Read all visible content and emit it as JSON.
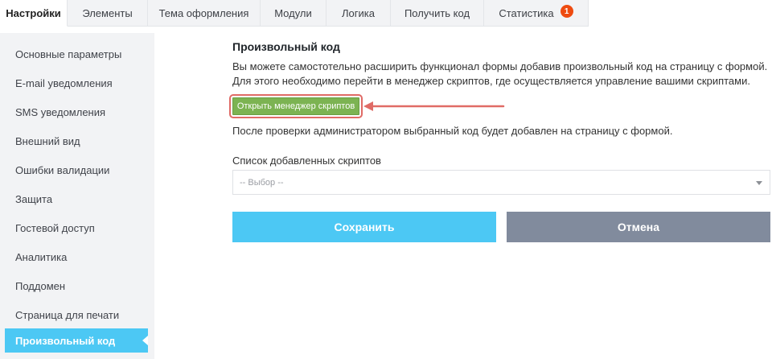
{
  "tabs": [
    {
      "label": "Настройки",
      "active": true
    },
    {
      "label": "Элементы"
    },
    {
      "label": "Тема оформления"
    },
    {
      "label": "Модули"
    },
    {
      "label": "Логика"
    },
    {
      "label": "Получить код"
    },
    {
      "label": "Статистика",
      "badge": "1"
    }
  ],
  "sidebar": {
    "items": [
      {
        "label": "Основные параметры"
      },
      {
        "label": "E-mail уведомления"
      },
      {
        "label": "SMS уведомления"
      },
      {
        "label": "Внешний вид"
      },
      {
        "label": "Ошибки валидации"
      },
      {
        "label": "Защита"
      },
      {
        "label": "Гостевой доступ"
      },
      {
        "label": "Аналитика"
      },
      {
        "label": "Поддомен"
      },
      {
        "label": "Страница для печати"
      },
      {
        "label": "Произвольный код",
        "active": true
      }
    ]
  },
  "main": {
    "title": "Произвольный код",
    "description": "Вы можете самостотельно расширить функционал формы добавив произвольный код на страницу с формой. Для этого необходимо перейти в менеджер скриптов, где осуществляется управление вашими скриптами.",
    "manager_button": "Открыть менеджер скриптов",
    "note": "После проверки администратором выбранный код будет добавлен на страницу с формой.",
    "scripts_label": "Список добавленных скриптов",
    "scripts_select_value": "-- Выбор --",
    "save_button": "Сохранить",
    "cancel_button": "Отмена"
  },
  "colors": {
    "accent": "#4cc8f4",
    "manager_button": "#7cb352",
    "highlight": "#e06b66",
    "cancel": "#818b9d",
    "badge": "#ee4b10"
  }
}
